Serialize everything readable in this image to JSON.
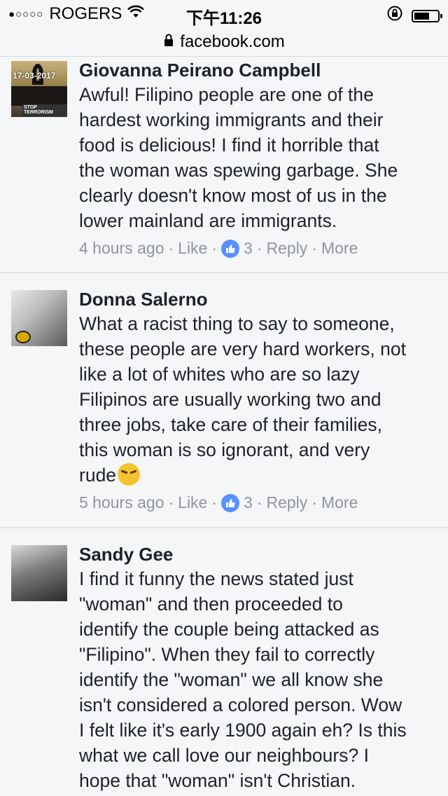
{
  "status_bar": {
    "signal_dots": "●○○○○",
    "carrier": "ROGERS",
    "time": "下午11:26",
    "battery_level": 0.65
  },
  "url_bar": {
    "domain": "facebook.com"
  },
  "comments": [
    {
      "name": "Giovanna Peirano Campbell",
      "avatar": {
        "date_text": "17-03-2017",
        "caption": "STOP TERRORISM"
      },
      "text": "Awful! Filipino people are one of the\nhardest working immigrants and their\nfood is delicious! I find it horrible that\nthe woman was spewing garbage. She\nclearly doesn't know most of us in the\nlower mainland are immigrants.",
      "time": "4 hours ago",
      "like_label": "Like",
      "like_count": "3",
      "reply_label": "Reply",
      "more_label": "More"
    },
    {
      "name": "Donna Salerno",
      "text": "What a racist thing to say to someone,\nthese people are very hard workers, not\nlike a lot of whites who are so lazy\nFilipinos are usually working two and\nthree jobs, take care of their families,\nthis woman is so ignorant, and very\nrude",
      "emoji": "unamused-face-emoji",
      "time": "5 hours ago",
      "like_label": "Like",
      "like_count": "3",
      "reply_label": "Reply",
      "more_label": "More"
    },
    {
      "name": "Sandy Gee",
      "text": "I find it funny the news stated just\n\"woman\" and then proceeded to\nidentify the couple being attacked as\n\"Filipino\". When they fail to correctly\nidentify the \"woman\" we all know she\nisn't considered a colored person. Wow\nI felt like it's early 1900 again eh? Is this\nwhat we call love our neighbours? I\nhope that \"woman\" isn't Christian."
    }
  ],
  "separator": "·",
  "colors": {
    "background": "#f5f6f7",
    "text": "#1d2129",
    "meta": "#90949c",
    "like_badge": "#5890ff"
  }
}
